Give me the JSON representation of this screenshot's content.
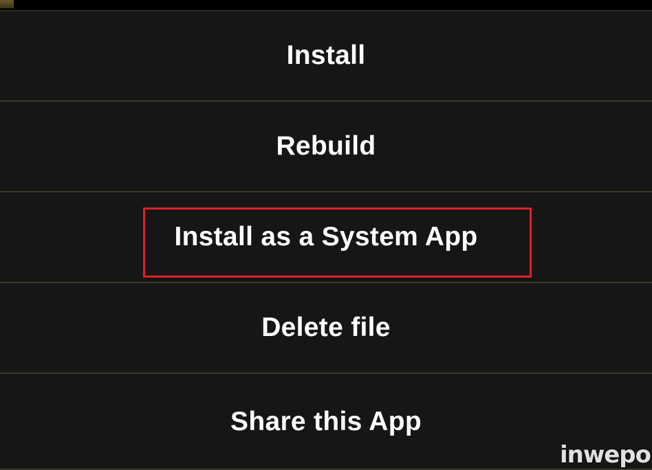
{
  "menu": {
    "items": [
      {
        "label": "Install"
      },
      {
        "label": "Rebuild"
      },
      {
        "label": "Install as a System App"
      },
      {
        "label": "Delete file"
      },
      {
        "label": "Share this App"
      }
    ]
  },
  "highlight": {
    "target": "Install as a System App",
    "color": "#e0202a"
  },
  "watermark": {
    "text": "inwepo"
  },
  "colors": {
    "background": "#161616",
    "divider": "#3c3927",
    "text": "#ffffff"
  }
}
